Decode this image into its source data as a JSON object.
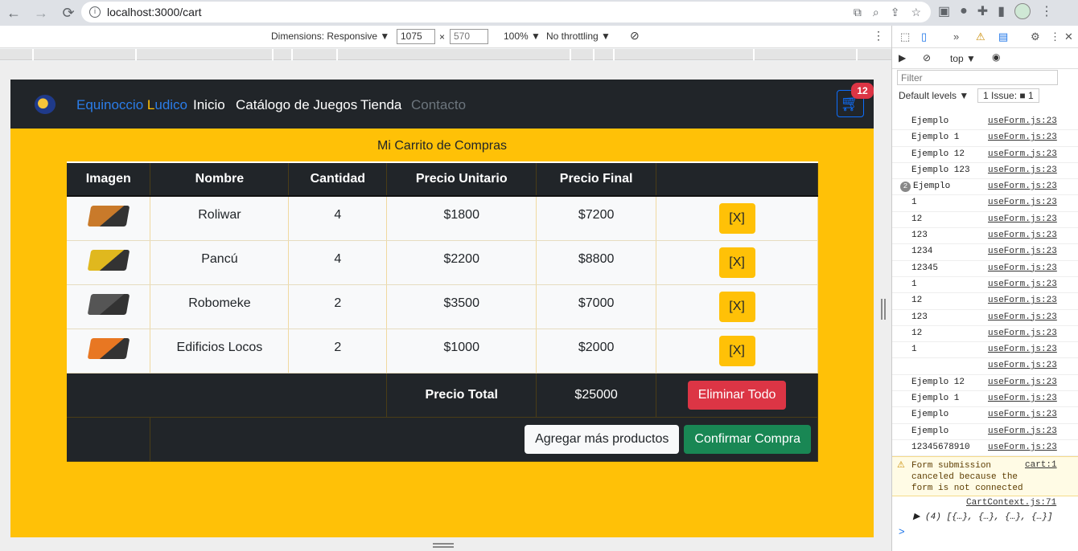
{
  "browser": {
    "back": "←",
    "forward": "→",
    "reload": "⟳",
    "url": "localhost:3000/cart",
    "info": "i"
  },
  "device_toolbar": {
    "dimensions_label": "Dimensions: Responsive ▼",
    "width": "1075",
    "height": "570",
    "times": "×",
    "zoom": "100% ▼",
    "throttle": "No throttling ▼"
  },
  "navbar": {
    "brand_part1": "Equinoccio ",
    "brand_part2": "L",
    "brand_part3": "udico",
    "links": [
      "Inicio",
      "Catálogo de Juegos",
      "Tienda",
      "Contacto"
    ],
    "cart_count": "12"
  },
  "cart": {
    "title": "Mi Carrito de Compras",
    "headers": [
      "Imagen",
      "Nombre",
      "Cantidad",
      "Precio Unitario",
      "Precio Final",
      ""
    ],
    "rows": [
      {
        "name": "Roliwar",
        "qty": "4",
        "unit": "$1800",
        "final": "$7200",
        "remove": "[X]",
        "color": "#c97a2a"
      },
      {
        "name": "Pancú",
        "qty": "4",
        "unit": "$2200",
        "final": "$8800",
        "remove": "[X]",
        "color": "#e0b81e"
      },
      {
        "name": "Robomeke",
        "qty": "2",
        "unit": "$3500",
        "final": "$7000",
        "remove": "[X]",
        "color": "#555555"
      },
      {
        "name": "Edificios Locos",
        "qty": "2",
        "unit": "$1000",
        "final": "$2000",
        "remove": "[X]",
        "color": "#e87722"
      }
    ],
    "total_label": "Precio Total",
    "total_value": "$25000",
    "clear_all": "Eliminar Todo",
    "add_more": "Agregar más productos",
    "confirm": "Confirmar Compra"
  },
  "devtools": {
    "context": "top ▼",
    "filter_placeholder": "Filter",
    "levels": "Default levels ▼",
    "issues": "1 Issue: ■ 1",
    "logs": [
      {
        "msg": "Ejemplo",
        "src": "useForm.js:23"
      },
      {
        "msg": "Ejemplo 1",
        "src": "useForm.js:23"
      },
      {
        "msg": "Ejemplo 12",
        "src": "useForm.js:23"
      },
      {
        "msg": "Ejemplo 123",
        "src": "useForm.js:23"
      },
      {
        "msg": "Ejemplo",
        "src": "useForm.js:23",
        "count": "2"
      },
      {
        "msg": "1",
        "src": "useForm.js:23"
      },
      {
        "msg": "12",
        "src": "useForm.js:23"
      },
      {
        "msg": "123",
        "src": "useForm.js:23"
      },
      {
        "msg": "1234",
        "src": "useForm.js:23"
      },
      {
        "msg": "12345",
        "src": "useForm.js:23"
      },
      {
        "msg": "1",
        "src": "useForm.js:23"
      },
      {
        "msg": "12",
        "src": "useForm.js:23"
      },
      {
        "msg": "123",
        "src": "useForm.js:23"
      },
      {
        "msg": "12",
        "src": "useForm.js:23"
      },
      {
        "msg": "1",
        "src": "useForm.js:23"
      },
      {
        "msg": "",
        "src": "useForm.js:23"
      },
      {
        "msg": "Ejemplo 12",
        "src": "useForm.js:23"
      },
      {
        "msg": "Ejemplo 1",
        "src": "useForm.js:23"
      },
      {
        "msg": "Ejemplo",
        "src": "useForm.js:23"
      },
      {
        "msg": "Ejemplo",
        "src": "useForm.js:23"
      },
      {
        "msg": "12345678910",
        "src": "useForm.js:23"
      }
    ],
    "warning": {
      "text": "Form submission canceled because the form is not connected",
      "src": "cart:1"
    },
    "context_src": "CartContext.js:71",
    "array_preview": "▶ (4) [{…}, {…}, {…}, {…}]",
    "prompt": ">"
  }
}
